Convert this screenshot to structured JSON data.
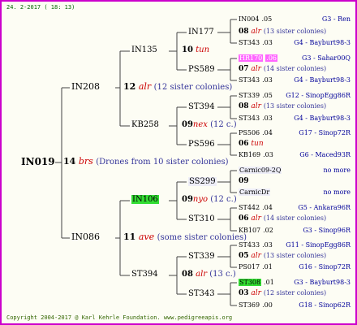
{
  "date": "24. 2-2017 ( 18: 13)",
  "copyright": "Copyright 2004-2017 @ Karl Kehrle Foundation.  www.pedigreeapis.org",
  "root": {
    "id": "IN019",
    "gen_num": "14",
    "race": "brs",
    "note": "(Drones from 10 sister colonies)"
  },
  "g1": [
    {
      "id": "IN208",
      "gen_num": "12",
      "race": "alr",
      "note": "(12 sister colonies)"
    },
    {
      "id": "IN086",
      "gen_num": "11",
      "race": "ave",
      "note": "(some sister colonies)"
    }
  ],
  "g2": [
    {
      "id": "IN135",
      "gen_num": "10",
      "race": "tun",
      "note": ""
    },
    {
      "id": "KB258",
      "gen_num": "09",
      "race": "nex",
      "note": "(12 c.)"
    },
    {
      "id": "IN106",
      "gen_num": "09",
      "race": "nyo",
      "note": "(12 c.)"
    },
    {
      "id": "ST394",
      "gen_num": "08",
      "race": "alr",
      "note": "(13 c.)"
    }
  ],
  "g3": [
    {
      "id": "IN177",
      "gen_num": "08",
      "race": "alr",
      "note": "(13 sister colonies)"
    },
    {
      "id": "PS589",
      "gen_num": "07",
      "race": "alr",
      "note": "(14 sister colonies)"
    },
    {
      "id": "ST394",
      "gen_num": "08",
      "race": "alr",
      "note": "(13 sister colonies)"
    },
    {
      "id": "PS596",
      "gen_num": "06",
      "race": "tun",
      "note": ""
    },
    {
      "id": "SS299",
      "gen_num": "09",
      "race": "",
      "note": ""
    },
    {
      "id": "ST310",
      "gen_num": "06",
      "race": "alr",
      "note": "(14 sister colonies)"
    },
    {
      "id": "ST339",
      "gen_num": "05",
      "race": "alr",
      "note": "(13 sister colonies)"
    },
    {
      "id": "ST343",
      "gen_num": "03",
      "race": "alr",
      "note": "(12 sister colonies)"
    }
  ],
  "g4": [
    {
      "id": "IN004",
      "year": ".05",
      "loc": "G3 - Ren"
    },
    {
      "id": "ST343",
      "year": ".03",
      "loc": "G4 - Bayburt98-3"
    },
    {
      "id": "HR170",
      "year": ".06",
      "loc": "G3 - Sahar00Q"
    },
    {
      "id": "ST343",
      "year": ".03",
      "loc": "G4 - Bayburt98-3"
    },
    {
      "id": "ST339",
      "year": ".05",
      "loc": "G12 - SinopEgg86R"
    },
    {
      "id": "ST343",
      "year": ".03",
      "loc": "G4 - Bayburt98-3"
    },
    {
      "id": "PS506",
      "year": ".04",
      "loc": "G17 - Sinop72R"
    },
    {
      "id": "KB169",
      "year": ".03",
      "loc": "G6 - Maced93R"
    },
    {
      "id": "Carnic09-2Q",
      "year": "",
      "loc": "no more"
    },
    {
      "id": "CarnicDr",
      "year": "",
      "loc": "no more"
    },
    {
      "id": "ST442",
      "year": ".04",
      "loc": "G5 - Ankara96R"
    },
    {
      "id": "KB107",
      "year": ".02",
      "loc": "G3 - Sinop96R"
    },
    {
      "id": "ST433",
      "year": ".03",
      "loc": "G11 - SinopEgg86R"
    },
    {
      "id": "PS017",
      "year": ".01",
      "loc": "G16 - Sinop72R"
    },
    {
      "id": "ST308",
      "year": ".01",
      "loc": "G3 - Bayburt98-3"
    },
    {
      "id": "ST369",
      "year": ".00",
      "loc": "G18 - Sinop62R"
    }
  ],
  "colors": {
    "border": "#cc00cc",
    "race": "#cc0000",
    "note": "#333399",
    "highlight_pink": "#ff66ff",
    "highlight_green": "#33dd33"
  }
}
